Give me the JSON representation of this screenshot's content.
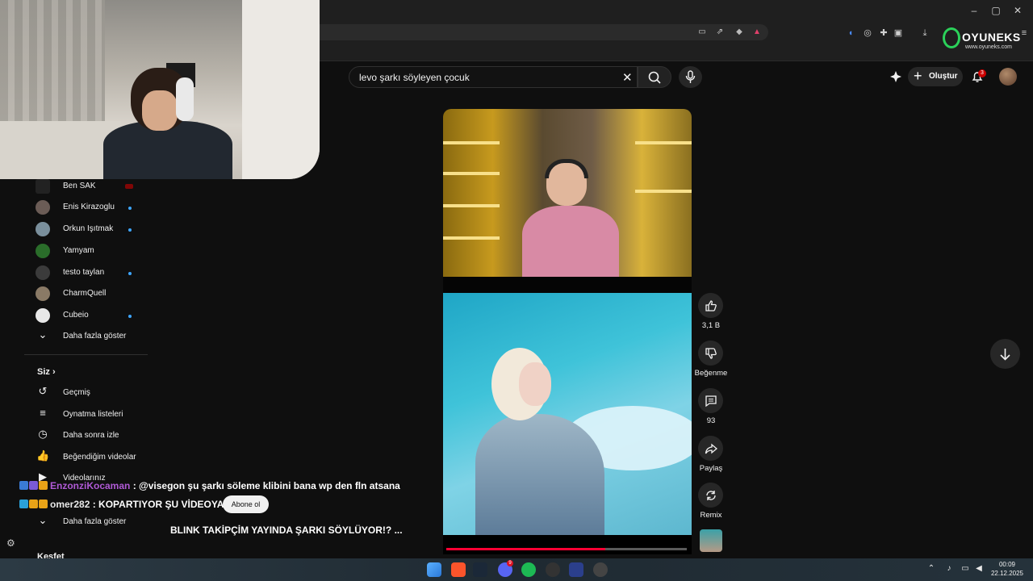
{
  "header": {
    "search_query": "levo şarkı söyleyen çocuk",
    "create_label": "Oluştur",
    "notification_count": "3"
  },
  "logo": {
    "name": "OYUNEKS",
    "url": "www.oyuneks.com"
  },
  "sidebar": {
    "subscriptions": [
      {
        "label": "Ben SAK"
      },
      {
        "label": "Enis Kirazoglu"
      },
      {
        "label": "Orkun Işıtmak"
      },
      {
        "label": "Yamyam"
      },
      {
        "label": "testo taylan"
      },
      {
        "label": "CharmQuell"
      },
      {
        "label": "Cubeio"
      }
    ],
    "show_more": "Daha fazla göster",
    "you_heading": "Siz",
    "you_items": [
      {
        "label": "Geçmiş"
      },
      {
        "label": "Oynatma listeleri"
      },
      {
        "label": "Daha sonra izle"
      },
      {
        "label": "Beğendiğim videolar"
      },
      {
        "label": "Videolarınız"
      }
    ],
    "show_more_2": "Daha fazla göster",
    "explore_heading": "Keşfet"
  },
  "actions": {
    "like_count": "3,1 B",
    "dislike_label": "Beğenme",
    "comment_count": "93",
    "share_label": "Paylaş",
    "remix_label": "Remix"
  },
  "short": {
    "title": "BLINK TAKİPÇİM YAYINDA ŞARKI SÖYLÜYOR!? ...",
    "subscribe_label": "Abone ol",
    "progress": 0.66
  },
  "chat": [
    {
      "user": "EnzonziKocaman",
      "message": ": @visegon şu şarkı söleme klibini bana wp den fln atsana"
    },
    {
      "user": "omer282",
      "message": ": KOPARTIYOR ŞU VİDEOYA BEN"
    }
  ],
  "taskbar": {
    "time": "00:09",
    "date": "22.12.2025",
    "discord_badge": "9"
  },
  "colors": {
    "accent_red": "#ff0033",
    "bg": "#0f0f0f",
    "chat_user1": "#b05ad6"
  }
}
